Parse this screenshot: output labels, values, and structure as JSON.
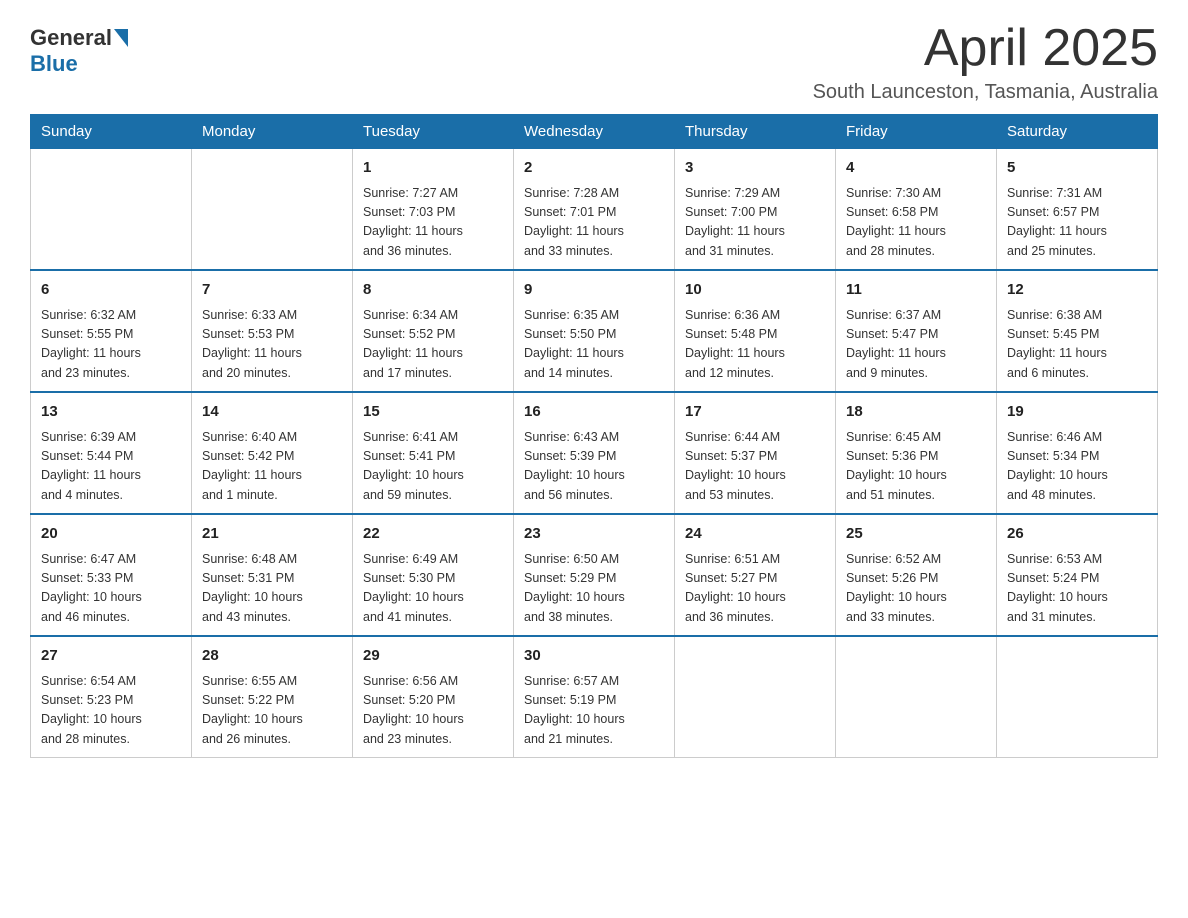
{
  "header": {
    "logo": {
      "general": "General",
      "blue": "Blue"
    },
    "title": "April 2025",
    "location": "South Launceston, Tasmania, Australia"
  },
  "weekdays": [
    "Sunday",
    "Monday",
    "Tuesday",
    "Wednesday",
    "Thursday",
    "Friday",
    "Saturday"
  ],
  "weeks": [
    [
      {
        "day": "",
        "info": ""
      },
      {
        "day": "",
        "info": ""
      },
      {
        "day": "1",
        "info": "Sunrise: 7:27 AM\nSunset: 7:03 PM\nDaylight: 11 hours\nand 36 minutes."
      },
      {
        "day": "2",
        "info": "Sunrise: 7:28 AM\nSunset: 7:01 PM\nDaylight: 11 hours\nand 33 minutes."
      },
      {
        "day": "3",
        "info": "Sunrise: 7:29 AM\nSunset: 7:00 PM\nDaylight: 11 hours\nand 31 minutes."
      },
      {
        "day": "4",
        "info": "Sunrise: 7:30 AM\nSunset: 6:58 PM\nDaylight: 11 hours\nand 28 minutes."
      },
      {
        "day": "5",
        "info": "Sunrise: 7:31 AM\nSunset: 6:57 PM\nDaylight: 11 hours\nand 25 minutes."
      }
    ],
    [
      {
        "day": "6",
        "info": "Sunrise: 6:32 AM\nSunset: 5:55 PM\nDaylight: 11 hours\nand 23 minutes."
      },
      {
        "day": "7",
        "info": "Sunrise: 6:33 AM\nSunset: 5:53 PM\nDaylight: 11 hours\nand 20 minutes."
      },
      {
        "day": "8",
        "info": "Sunrise: 6:34 AM\nSunset: 5:52 PM\nDaylight: 11 hours\nand 17 minutes."
      },
      {
        "day": "9",
        "info": "Sunrise: 6:35 AM\nSunset: 5:50 PM\nDaylight: 11 hours\nand 14 minutes."
      },
      {
        "day": "10",
        "info": "Sunrise: 6:36 AM\nSunset: 5:48 PM\nDaylight: 11 hours\nand 12 minutes."
      },
      {
        "day": "11",
        "info": "Sunrise: 6:37 AM\nSunset: 5:47 PM\nDaylight: 11 hours\nand 9 minutes."
      },
      {
        "day": "12",
        "info": "Sunrise: 6:38 AM\nSunset: 5:45 PM\nDaylight: 11 hours\nand 6 minutes."
      }
    ],
    [
      {
        "day": "13",
        "info": "Sunrise: 6:39 AM\nSunset: 5:44 PM\nDaylight: 11 hours\nand 4 minutes."
      },
      {
        "day": "14",
        "info": "Sunrise: 6:40 AM\nSunset: 5:42 PM\nDaylight: 11 hours\nand 1 minute."
      },
      {
        "day": "15",
        "info": "Sunrise: 6:41 AM\nSunset: 5:41 PM\nDaylight: 10 hours\nand 59 minutes."
      },
      {
        "day": "16",
        "info": "Sunrise: 6:43 AM\nSunset: 5:39 PM\nDaylight: 10 hours\nand 56 minutes."
      },
      {
        "day": "17",
        "info": "Sunrise: 6:44 AM\nSunset: 5:37 PM\nDaylight: 10 hours\nand 53 minutes."
      },
      {
        "day": "18",
        "info": "Sunrise: 6:45 AM\nSunset: 5:36 PM\nDaylight: 10 hours\nand 51 minutes."
      },
      {
        "day": "19",
        "info": "Sunrise: 6:46 AM\nSunset: 5:34 PM\nDaylight: 10 hours\nand 48 minutes."
      }
    ],
    [
      {
        "day": "20",
        "info": "Sunrise: 6:47 AM\nSunset: 5:33 PM\nDaylight: 10 hours\nand 46 minutes."
      },
      {
        "day": "21",
        "info": "Sunrise: 6:48 AM\nSunset: 5:31 PM\nDaylight: 10 hours\nand 43 minutes."
      },
      {
        "day": "22",
        "info": "Sunrise: 6:49 AM\nSunset: 5:30 PM\nDaylight: 10 hours\nand 41 minutes."
      },
      {
        "day": "23",
        "info": "Sunrise: 6:50 AM\nSunset: 5:29 PM\nDaylight: 10 hours\nand 38 minutes."
      },
      {
        "day": "24",
        "info": "Sunrise: 6:51 AM\nSunset: 5:27 PM\nDaylight: 10 hours\nand 36 minutes."
      },
      {
        "day": "25",
        "info": "Sunrise: 6:52 AM\nSunset: 5:26 PM\nDaylight: 10 hours\nand 33 minutes."
      },
      {
        "day": "26",
        "info": "Sunrise: 6:53 AM\nSunset: 5:24 PM\nDaylight: 10 hours\nand 31 minutes."
      }
    ],
    [
      {
        "day": "27",
        "info": "Sunrise: 6:54 AM\nSunset: 5:23 PM\nDaylight: 10 hours\nand 28 minutes."
      },
      {
        "day": "28",
        "info": "Sunrise: 6:55 AM\nSunset: 5:22 PM\nDaylight: 10 hours\nand 26 minutes."
      },
      {
        "day": "29",
        "info": "Sunrise: 6:56 AM\nSunset: 5:20 PM\nDaylight: 10 hours\nand 23 minutes."
      },
      {
        "day": "30",
        "info": "Sunrise: 6:57 AM\nSunset: 5:19 PM\nDaylight: 10 hours\nand 21 minutes."
      },
      {
        "day": "",
        "info": ""
      },
      {
        "day": "",
        "info": ""
      },
      {
        "day": "",
        "info": ""
      }
    ]
  ]
}
